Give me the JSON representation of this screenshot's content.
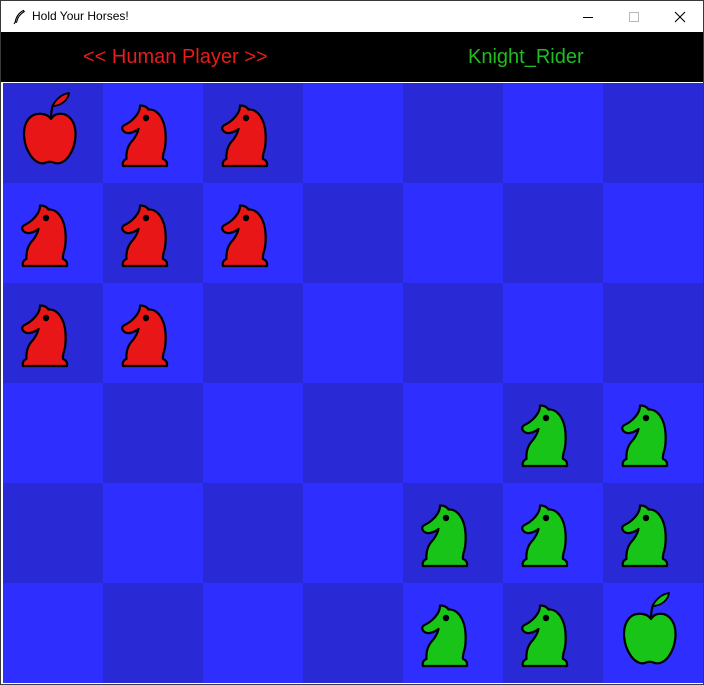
{
  "window": {
    "title": "Hold Your Horses!"
  },
  "status": {
    "player1": "<< Human Player >>",
    "player2": "Knight_Rider"
  },
  "colors": {
    "square_light": "#2e2eff",
    "square_dark": "#2929d6",
    "red": "#e81616",
    "green": "#18c418",
    "status_red": "#e81c1c",
    "status_green": "#1fbd1f"
  },
  "board": {
    "columns": 7,
    "rows": 6,
    "cells": [
      [
        "red-apple",
        "red-knight",
        "red-knight",
        "",
        "",
        "",
        ""
      ],
      [
        "red-knight",
        "red-knight",
        "red-knight",
        "",
        "",
        "",
        ""
      ],
      [
        "red-knight",
        "red-knight",
        "",
        "",
        "",
        "",
        ""
      ],
      [
        "",
        "",
        "",
        "",
        "",
        "green-knight",
        "green-knight"
      ],
      [
        "",
        "",
        "",
        "",
        "green-knight",
        "green-knight",
        "green-knight"
      ],
      [
        "",
        "",
        "",
        "",
        "green-knight",
        "green-knight",
        "green-apple"
      ]
    ]
  }
}
